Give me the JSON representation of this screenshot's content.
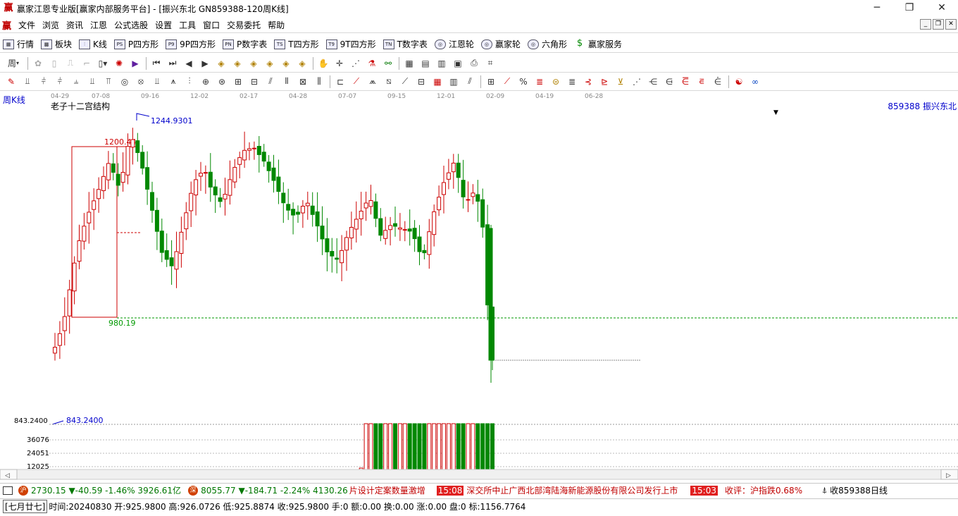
{
  "window": {
    "title": "赢家江恩专业版[赢家内部服务平台] - [振兴东北  GN859388-120周K线]",
    "logo": "赢",
    "controls": [
      "─",
      "❐",
      "✕"
    ]
  },
  "menu": {
    "logo": "赢",
    "items": [
      "文件",
      "浏览",
      "资讯",
      "江恩",
      "公式选股",
      "设置",
      "工具",
      "窗口",
      "交易委托",
      "帮助"
    ]
  },
  "toolbar1": {
    "items": [
      {
        "label": "行情",
        "icon": "▦"
      },
      {
        "label": "板块",
        "icon": "▩"
      },
      {
        "label": "K线",
        "icon": "⫶"
      },
      {
        "label": "P四方形",
        "icon": "PS"
      },
      {
        "label": "9P四方形",
        "icon": "P9"
      },
      {
        "label": "P数字表",
        "icon": "PN"
      },
      {
        "label": "T四方形",
        "icon": "TS"
      },
      {
        "label": "9T四方形",
        "icon": "T9"
      },
      {
        "label": "T数字表",
        "icon": "TN"
      },
      {
        "label": "江恩轮",
        "icon": "◎"
      },
      {
        "label": "赢家轮",
        "icon": "◎"
      },
      {
        "label": "六角形",
        "icon": "◎"
      },
      {
        "label": "赢家服务",
        "icon": "$"
      }
    ]
  },
  "toolbar2": {
    "period_label": "周"
  },
  "chart": {
    "period_label": "周K线",
    "indicator_label": "老子十二宫结构",
    "symbol_label": "859388  振兴东北",
    "price_min_label": "843.2400",
    "price_min_value_label": "843.2400",
    "high_label": "1244.9301",
    "box_high_label": "1200.44",
    "box_low_label": "980.19",
    "volume_labels": [
      "36076",
      "24051",
      "12025"
    ],
    "date_labels": [
      "04-29",
      "07-08",
      "09-16",
      "12-02",
      "02-17",
      "04-28",
      "07-07",
      "09-15",
      "12-01",
      "02-09",
      "04-19",
      "06-28"
    ],
    "scroll_left": "◁",
    "scroll_right": "▷",
    "colors": {
      "up": "#cc0000",
      "down": "#008800",
      "box": "#cc0000",
      "support": "#009900",
      "label_blue": "#0000cc"
    }
  },
  "chart_data": {
    "type": "candlestick",
    "title": "老子十二宫结构",
    "ylim": [
      843.24,
      1244.93
    ],
    "annotations": {
      "high": 1244.9301,
      "low": 843.24,
      "box_high": 1200.44,
      "box_low": 980.19
    },
    "volume_ticks": [
      36076,
      24051,
      12025
    ]
  },
  "status1": {
    "sh_icon": "沪",
    "sh_text": "2730.15 ▼-40.59 -1.46% 3926.61亿",
    "sz_icon": "深",
    "sz_text": "8055.77 ▼-184.71 -2.24% 4130.26",
    "news1": "片设计定案数量激增",
    "time1": "15:08",
    "news2": "深交所中止广西北部湾陆海新能源股份有限公司发行上市",
    "time2": "15:03",
    "news3": "收评：沪指跌0.68%",
    "right_icon": "⍋",
    "right_text": "收859388日线"
  },
  "status2": {
    "bracket": "[七月廿七]",
    "info": "时间:20240830 开:925.9800 高:926.0726 低:925.8874 收:925.9800 手:0 额:0.00 换:0.00 涨:0.00 盘:0 标:1156.7764"
  }
}
